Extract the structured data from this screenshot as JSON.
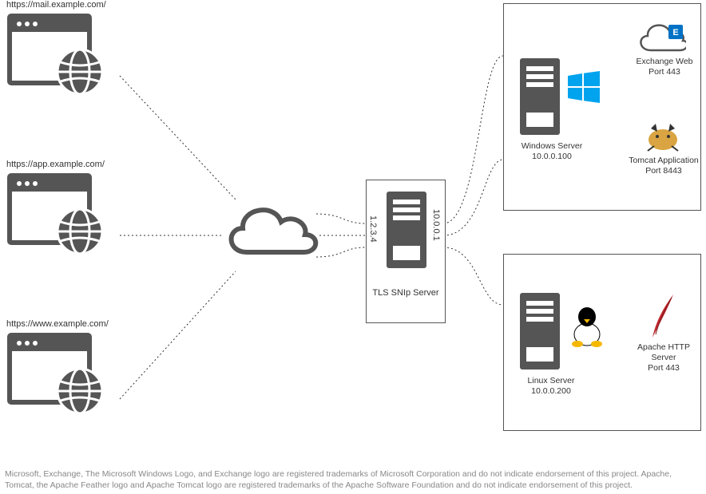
{
  "clients": [
    {
      "url": "https://mail.example.com/"
    },
    {
      "url": "https://app.example.com/"
    },
    {
      "url": "https://www.example.com/"
    }
  ],
  "proxy": {
    "name": "TLS SNIp Server",
    "ip_external": "1.2.3.4",
    "ip_internal": "10.0.0.1"
  },
  "backends": {
    "windows": {
      "label_name": "Windows Server",
      "label_ip": "10.0.0.100",
      "services": [
        {
          "name": "Exchange Web",
          "port": "Port 443"
        },
        {
          "name": "Tomcat Application",
          "port": "Port 8443"
        }
      ]
    },
    "linux": {
      "label_name": "Linux Server",
      "label_ip": "10.0.0.200",
      "services": [
        {
          "name": "Apache HTTP Server",
          "port": "Port 443"
        }
      ]
    }
  },
  "footnote": "Microsoft, Exchange, The Microsoft Windows Logo, and Exchange logo are registered trademarks of Microsoft Corporation and do not indicate endorsement of this project.  Apache, Tomcat, the Apache Feather logo and Apache Tomcat logo are registered trademarks of the Apache Software Foundation and do not indicate endorsement of this project."
}
